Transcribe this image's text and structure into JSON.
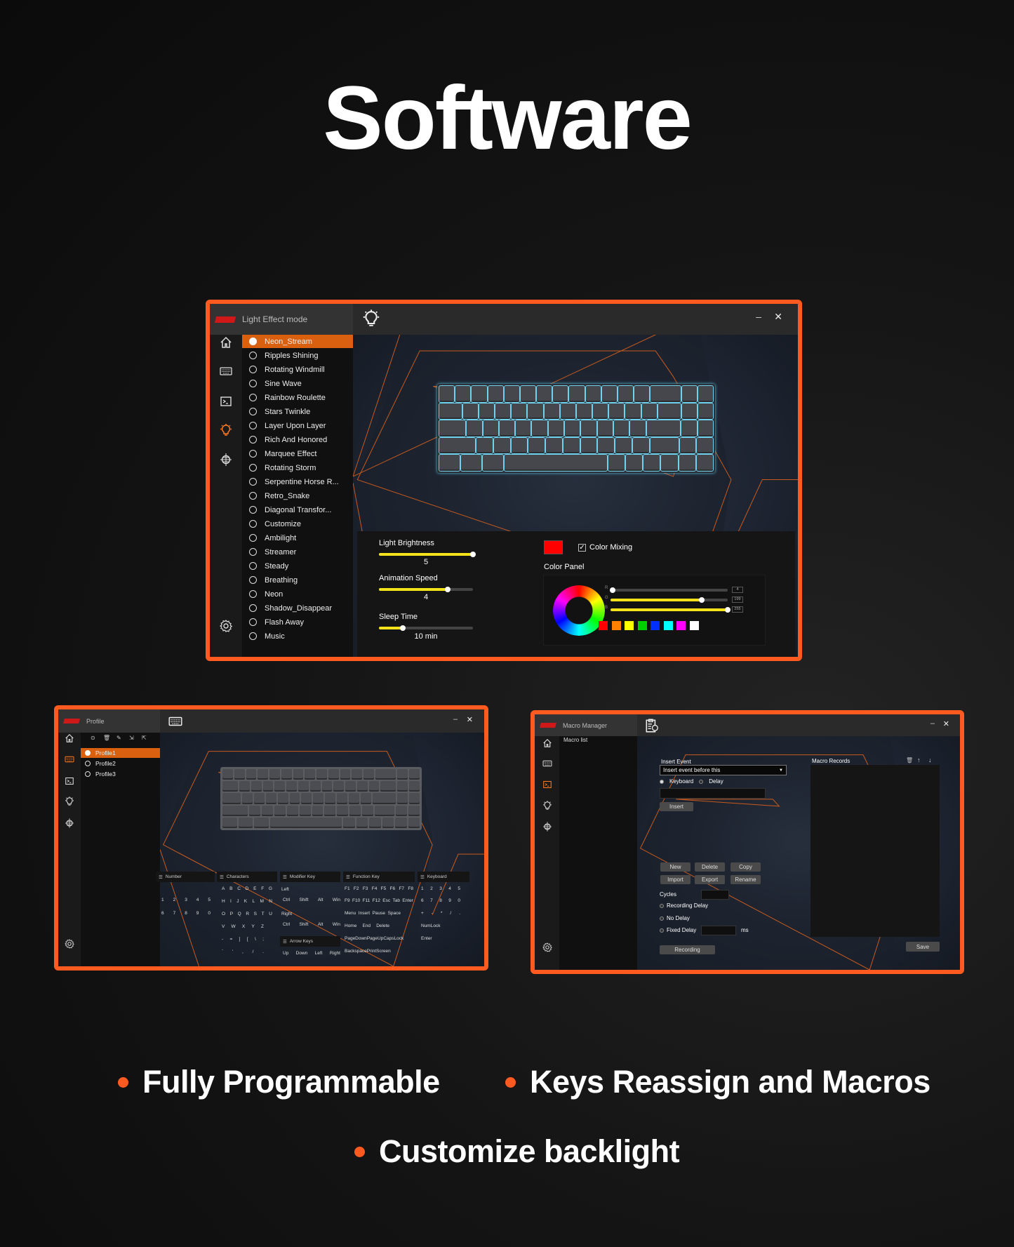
{
  "page": {
    "title": "Software",
    "accent": "#ff5a1f"
  },
  "features": [
    "Fully Programmable",
    "Keys Reassign and Macros",
    "Customize backlight"
  ],
  "light_window": {
    "title": "Light Effect mode",
    "header_icon": "bulb-icon",
    "selected_index": 0,
    "effects": [
      "Neon_Stream",
      "Ripples Shining",
      "Rotating Windmill",
      "Sine Wave",
      "Rainbow Roulette",
      "Stars Twinkle",
      "Layer Upon Layer",
      "Rich And Honored",
      "Marquee Effect",
      "Rotating Storm",
      "Serpentine Horse R...",
      "Retro_Snake",
      "Diagonal Transfor...",
      "Customize",
      "Ambilight",
      "Streamer",
      "Steady",
      "Breathing",
      "Neon",
      "Shadow_Disappear",
      "Flash Away",
      "Music"
    ],
    "controls": {
      "brightness": {
        "label": "Light Brightness",
        "value": "5",
        "level": 1.0
      },
      "speed": {
        "label": "Animation Speed",
        "value": "4",
        "level": 0.73
      },
      "sleep": {
        "label": "Sleep Time",
        "value": "10 min",
        "level": 0.25
      }
    },
    "color": {
      "current": "#ff0000",
      "mixing_label": "Color Mixing",
      "mixing_checked": true,
      "panel_label": "Color Panel",
      "rgb": [
        {
          "label": "R",
          "value": "4"
        },
        {
          "label": "G",
          "value": "199"
        },
        {
          "label": "B",
          "value": "255"
        }
      ],
      "swatches": [
        "#ff0000",
        "#ff8000",
        "#ffff00",
        "#00d000",
        "#0030ff",
        "#00ffff",
        "#ff00ff",
        "#ffffff"
      ]
    },
    "backlight_color": "#6fd3f0"
  },
  "profile_window": {
    "title": "Profile",
    "header_icon": "keyboard-icon",
    "selected_index": 0,
    "profiles": [
      "Profile1",
      "Profile2",
      "Profile3"
    ],
    "key_panel": {
      "number": {
        "label": "Number",
        "rows": [
          [
            "1",
            "2",
            "3",
            "4",
            "5"
          ],
          [
            "6",
            "7",
            "8",
            "9",
            "0"
          ]
        ]
      },
      "characters": {
        "label": "Characters",
        "rows": [
          [
            "A",
            "B",
            "C",
            "D",
            "E",
            "F",
            "G"
          ],
          [
            "H",
            "I",
            "J",
            "K",
            "L",
            "M",
            "N"
          ],
          [
            "O",
            "P",
            "Q",
            "R",
            "S",
            "T",
            "U"
          ],
          [
            "V",
            "W",
            "X",
            "Y",
            "Z"
          ],
          [
            "-",
            "=",
            "]",
            "[",
            "\\",
            ";"
          ],
          [
            "`",
            "'",
            ",",
            "/",
            "."
          ]
        ]
      },
      "modifier": {
        "label": "Modifier Key",
        "left_label": "Left",
        "right_label": "Right",
        "left_keys": [
          "Ctrl",
          "Shift",
          "Alt",
          "Win"
        ],
        "right_keys": [
          "Ctrl",
          "Shift",
          "Alt",
          "Win"
        ]
      },
      "arrow": {
        "label": "Arrow Keys",
        "keys": [
          "Up",
          "Down",
          "Left",
          "Right"
        ]
      },
      "function": {
        "label": "Function Key",
        "rows": [
          [
            "F1",
            "F2",
            "F3",
            "F4",
            "F5",
            "F6",
            "F7",
            "F8"
          ],
          [
            "F9",
            "F10",
            "F11",
            "F12",
            "Esc",
            "Tab",
            "Enter"
          ],
          [
            "Menu",
            "Insert",
            "Pause",
            "Space"
          ],
          [
            "Home",
            "End",
            "Delete"
          ],
          [
            "PageDown",
            "PageUp",
            "CapsLock"
          ],
          [
            "Backspace",
            "PrintScreen"
          ]
        ]
      },
      "keyboard": {
        "label": "Keyboard",
        "rows": [
          [
            "1",
            "2",
            "3",
            "4",
            "5"
          ],
          [
            "6",
            "7",
            "8",
            "9",
            "0"
          ],
          [
            "+",
            "-",
            "*",
            "/",
            "."
          ],
          [
            "NumLock"
          ],
          [
            "Enter"
          ]
        ]
      }
    }
  },
  "macro_window": {
    "title": "Macro Manager",
    "header_icon": "clipboard-icon",
    "macro_list_label": "Macro list",
    "insert_event_label": "Insert Event",
    "insert_mode": "Insert event before this",
    "event_types": [
      {
        "label": "Keyboard",
        "selected": true
      },
      {
        "label": "Delay",
        "selected": false
      }
    ],
    "event_value": "",
    "insert_button": "Insert",
    "buttons": [
      "New",
      "Delete",
      "Copy",
      "Import",
      "Export",
      "Rename"
    ],
    "cycles_label": "Cycles",
    "cycles_value": "",
    "delay_options": [
      "Recording Delay",
      "No Delay",
      "Fixed Delay"
    ],
    "fixed_delay_value": "",
    "ms_label": "ms",
    "recording_button": "Recording",
    "records_label": "Macro Records",
    "save_button": "Save"
  }
}
